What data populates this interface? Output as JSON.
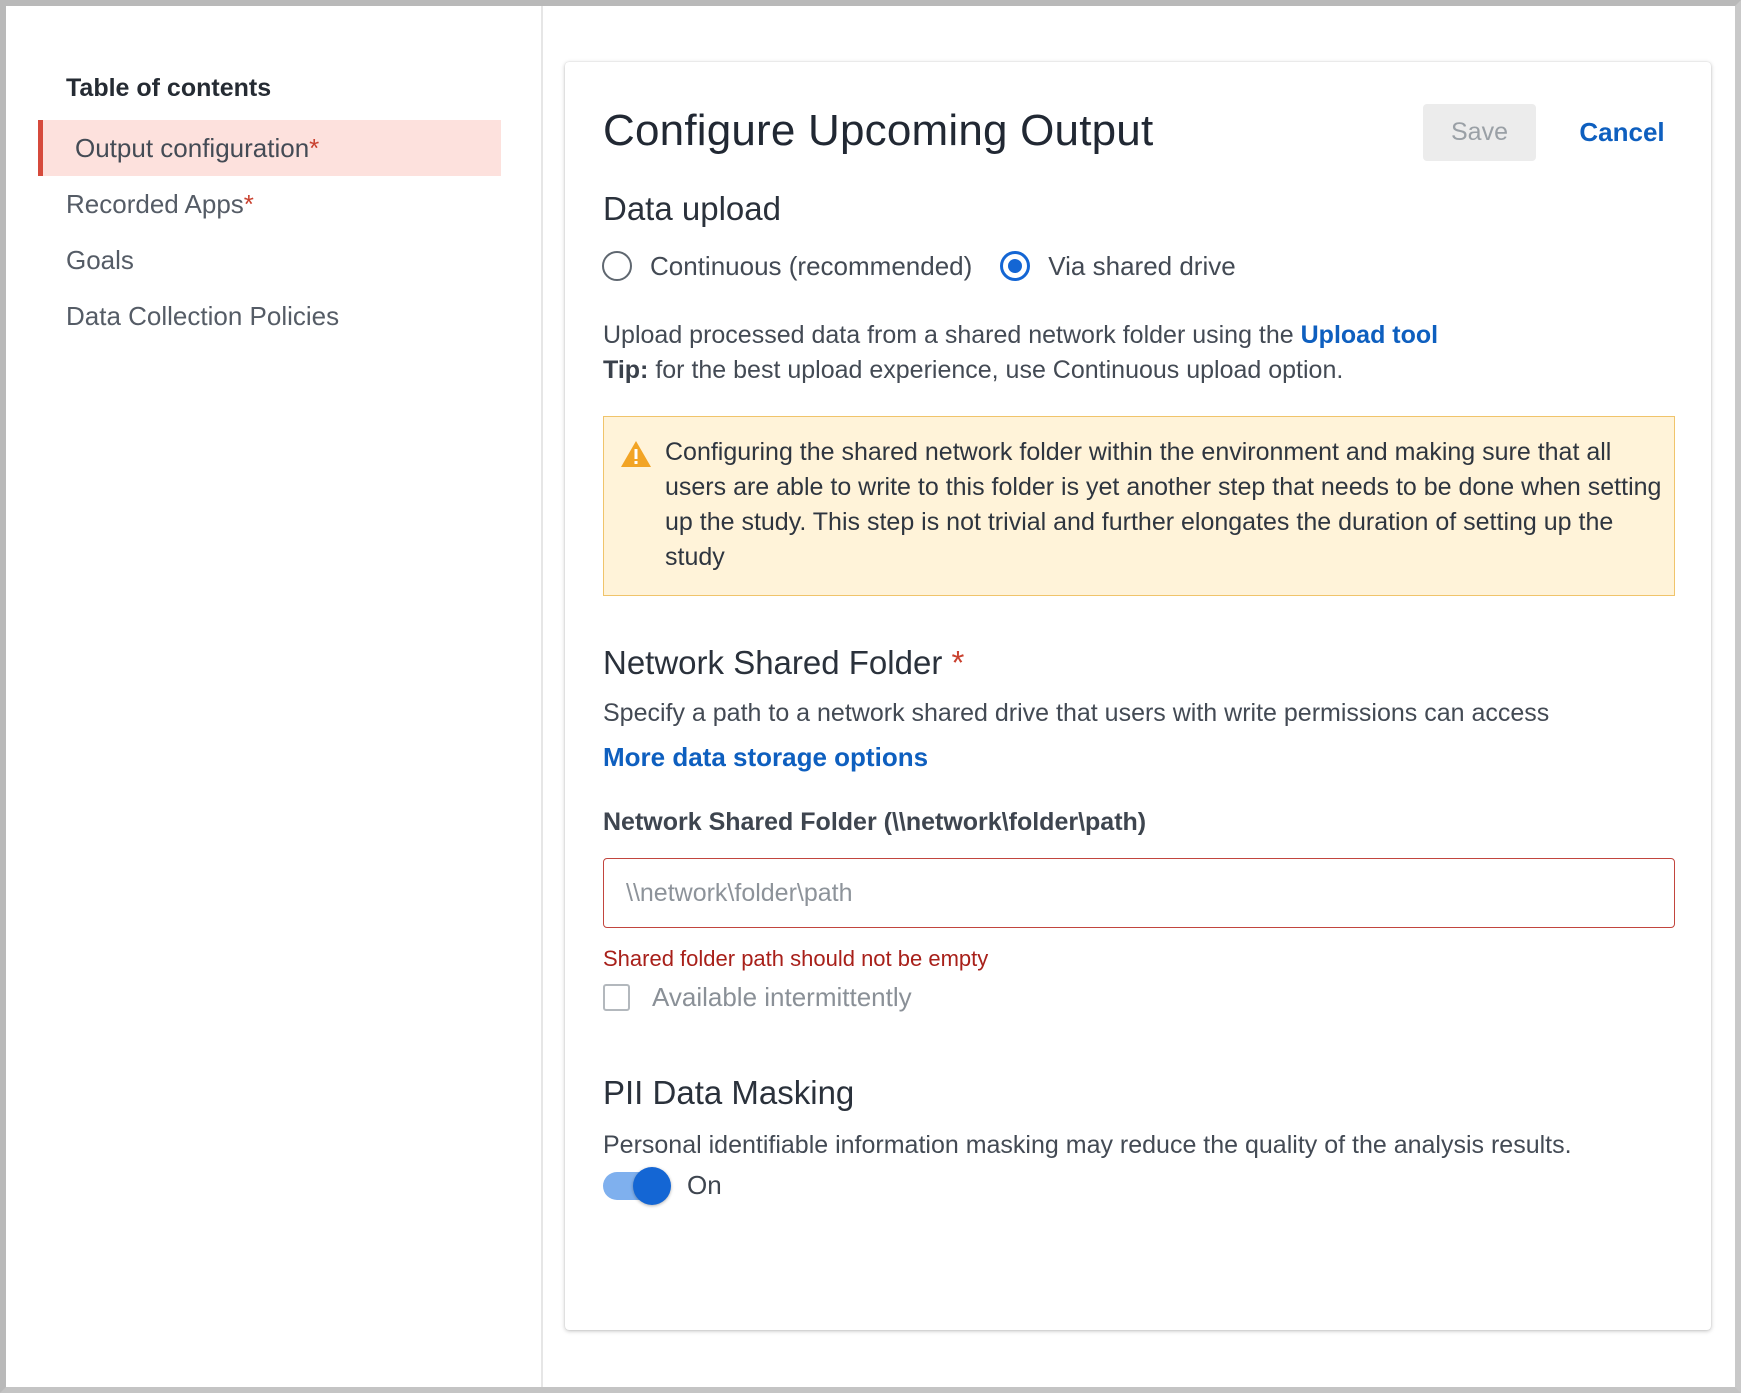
{
  "sidebar": {
    "title": "Table of contents",
    "items": [
      {
        "label": "Output configuration",
        "required": "*",
        "active": true
      },
      {
        "label": "Recorded Apps",
        "required": "*",
        "active": false
      },
      {
        "label": "Goals",
        "required": "",
        "active": false
      },
      {
        "label": "Data Collection Policies",
        "required": "",
        "active": false
      }
    ]
  },
  "header": {
    "title": "Configure Upcoming Output",
    "save_label": "Save",
    "cancel_label": "Cancel"
  },
  "data_upload": {
    "heading": "Data upload",
    "options": [
      {
        "label": "Continuous (recommended)",
        "selected": false
      },
      {
        "label": "Via shared drive",
        "selected": true
      }
    ],
    "description": "Upload processed data from a shared network folder using the ",
    "upload_tool_link": "Upload tool",
    "tip_label": "Tip:",
    "tip_text": " for the best upload experience, use Continuous upload option."
  },
  "warning": {
    "icon": "warning-triangle-icon",
    "text": "Configuring the shared network folder within the environment and making sure that all users are able to write to this folder is yet another step that needs to be done when setting up the study. This step is not trivial and further elongates the duration of setting up the study"
  },
  "network_folder": {
    "heading": "Network Shared Folder",
    "required": "*",
    "description": "Specify a path to a network shared drive that users with write permissions can access",
    "more_link": "More data storage options",
    "field_label": "Network Shared Folder (\\\\network\\folder\\path)",
    "input_value": "",
    "input_placeholder": "\\\\network\\folder\\path",
    "error": "Shared folder path should not be empty",
    "checkbox_label": "Available intermittently",
    "checkbox_checked": false
  },
  "pii": {
    "heading": "PII Data Masking",
    "description": "Personal identifiable information masking may reduce the quality of the analysis results.",
    "toggle_label": "On",
    "toggle_on": true
  },
  "colors": {
    "accent": "#1466d4",
    "link": "#0e5fbf",
    "required": "#c9412f",
    "active_bg": "#fde1dd",
    "warning_bg": "#fff3d9",
    "warning_border": "#f0c46b",
    "error": "#a8201a"
  }
}
